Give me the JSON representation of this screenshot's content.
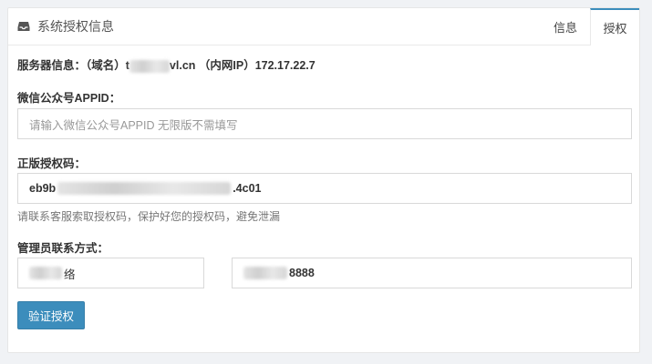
{
  "header": {
    "title": "系统授权信息",
    "icon": "inbox-icon",
    "tabs": [
      {
        "label": "信息",
        "active": false
      },
      {
        "label": "授权",
        "active": true
      }
    ]
  },
  "server_info": {
    "text_prefix": "服务器信息：（域名）t",
    "text_suffix": "vl.cn （内网IP）172.17.22.7"
  },
  "appid": {
    "label": "微信公众号APPID：",
    "placeholder": "请输入微信公众号APPID 无限版不需填写",
    "value": ""
  },
  "license": {
    "label": "正版授权码：",
    "value_prefix": "eb9b",
    "value_suffix": ".4c01",
    "help": "请联系客服索取授权码，保护好您的授权码，避免泄漏"
  },
  "contact": {
    "label": "管理员联系方式：",
    "name_suffix": "络",
    "phone_suffix": "8888"
  },
  "verify_button": "验证授权",
  "colors": {
    "accent": "#3c8dbc",
    "border": "#d9d9d9"
  }
}
